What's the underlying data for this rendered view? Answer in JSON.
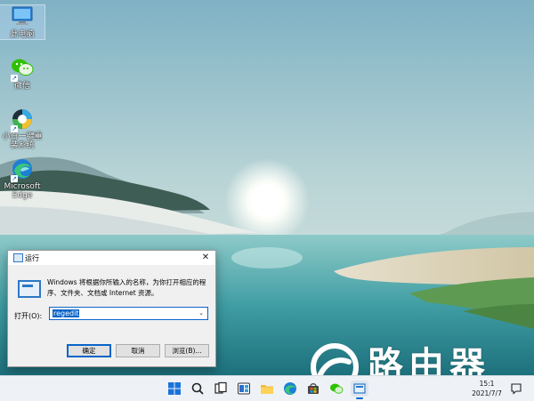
{
  "desktop": {
    "icons": [
      {
        "name": "this-pc-icon",
        "label": "此电脑"
      },
      {
        "name": "wechat-icon",
        "label": "微信"
      },
      {
        "name": "xiaobai-icon",
        "label": "小白一键重装系统"
      },
      {
        "name": "edge-icon",
        "label": "Microsoft Edge"
      }
    ]
  },
  "run_dialog": {
    "title": "运行",
    "close_glyph": "✕",
    "description": "Windows 将根据你所输入的名称，为你打开相应的程序、文件夹、文档或 Internet 资源。",
    "open_label": "打开(O):",
    "input_value": "regedit",
    "buttons": {
      "ok": "确定",
      "cancel": "取消",
      "browse": "浏览(B)..."
    }
  },
  "taskbar": {
    "items": [
      "start-icon",
      "search-icon",
      "task-view-icon",
      "widgets-icon",
      "file-explorer-icon",
      "edge-icon",
      "store-icon",
      "wechat-icon",
      "run-icon"
    ],
    "tray": {
      "time": "15:1",
      "date": "2021/7/7"
    }
  },
  "watermark": {
    "text": "路由器"
  },
  "colors": {
    "accent": "#0a64c8",
    "taskbar": "#eef2f6",
    "dialog": "#f0f0f0"
  }
}
